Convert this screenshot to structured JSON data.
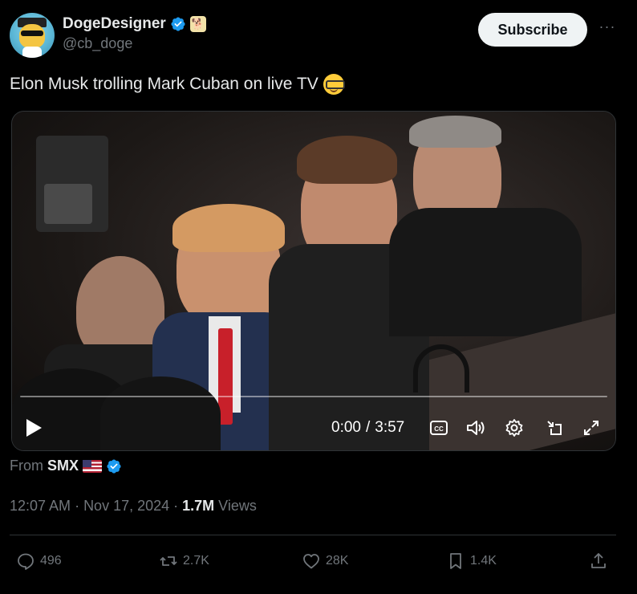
{
  "author": {
    "display_name": "DogeDesigner",
    "handle": "@cb_doge",
    "verified": true,
    "affiliate_badge_icon": "doge-badge-icon"
  },
  "subscribe_label": "Subscribe",
  "more_label": "···",
  "tweet": {
    "text": "Elon Musk trolling Mark Cuban on live TV",
    "emoji": "nerd-face-emoji"
  },
  "video": {
    "current_time": "0:00",
    "separator": "/",
    "duration": "3:57",
    "progress": 0,
    "controls": [
      "play-icon",
      "captions-icon",
      "volume-icon",
      "settings-icon",
      "minimize-icon",
      "fullscreen-icon"
    ]
  },
  "source": {
    "prefix": "From",
    "name": "SMX",
    "flag": "us-flag-icon",
    "verified": true
  },
  "meta": {
    "time": "12:07 AM",
    "dot": "·",
    "date": "Nov 17, 2024",
    "views_count": "1.7M",
    "views_label": "Views"
  },
  "actions": {
    "replies": "496",
    "reposts": "2.7K",
    "likes": "28K",
    "bookmarks": "1.4K"
  },
  "colors": {
    "background": "#000000",
    "text_primary": "#e7e9ea",
    "text_secondary": "#71767b",
    "accent_blue": "#1d9bf0",
    "subscribe_bg": "#eff3f4"
  }
}
